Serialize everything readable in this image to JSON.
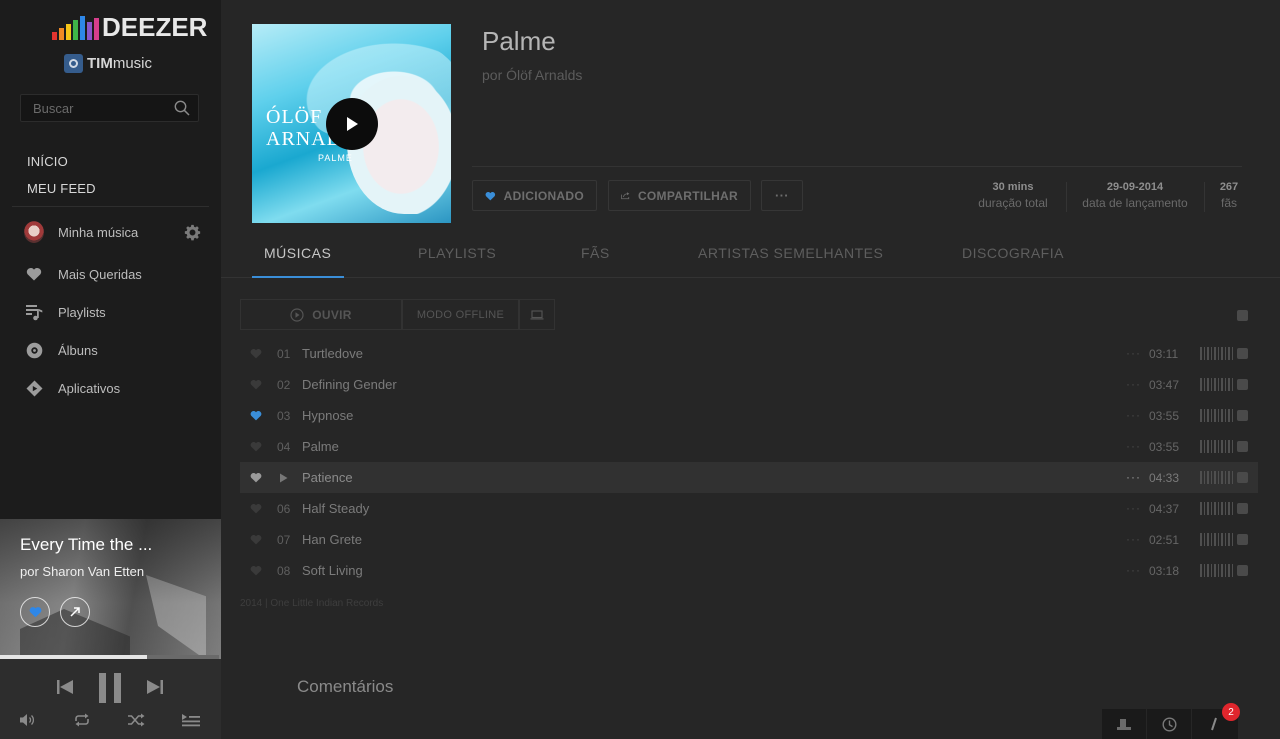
{
  "brand": {
    "logo_text": "DEEZER",
    "partner_bold": "TIM",
    "partner_rest": "music",
    "eq_colors": [
      "#e3342f",
      "#f08a24",
      "#f5c518",
      "#3fb548",
      "#2e87e8",
      "#8a56c9",
      "#d63e8c"
    ]
  },
  "search": {
    "placeholder": "Buscar"
  },
  "nav_top": [
    "INÍCIO",
    "MEU FEED"
  ],
  "sidebar": {
    "items": [
      {
        "label": "Minha música",
        "icon": "avatar"
      },
      {
        "label": "Mais Queridas",
        "icon": "heart-icon"
      },
      {
        "label": "Playlists",
        "icon": "playlist-icon"
      },
      {
        "label": "Álbuns",
        "icon": "album-icon"
      },
      {
        "label": "Aplicativos",
        "icon": "apps-icon"
      }
    ]
  },
  "player": {
    "title": "Every Time the ...",
    "artist": "por Sharon Van Etten",
    "progress": 0.67
  },
  "album": {
    "title": "Palme",
    "by": "por Ólöf Arnalds",
    "cover_text": {
      "line1": "ÓLÖF",
      "line2": "ARNALDS",
      "line3": "PALME"
    },
    "actions": {
      "added": "ADICIONADO",
      "share": "COMPARTILHAR",
      "more": "···"
    },
    "stats": [
      {
        "value": "30 mins",
        "label": "duração total"
      },
      {
        "value": "29-09-2014",
        "label": "data de lançamento"
      },
      {
        "value": "267",
        "label": "fãs"
      }
    ]
  },
  "tabs": [
    "MÚSICAS",
    "PLAYLISTS",
    "FÃS",
    "ARTISTAS SEMELHANTES",
    "DISCOGRAFIA"
  ],
  "toolbar": {
    "listen": "OUVIR",
    "offline": "MODO OFFLINE"
  },
  "tracks": [
    {
      "num": "01",
      "title": "Turtledove",
      "duration": "03:11",
      "favorite": false,
      "playing": false
    },
    {
      "num": "02",
      "title": "Defining Gender",
      "duration": "03:47",
      "favorite": false,
      "playing": false
    },
    {
      "num": "03",
      "title": "Hypnose",
      "duration": "03:55",
      "favorite": true,
      "playing": false
    },
    {
      "num": "04",
      "title": "Palme",
      "duration": "03:55",
      "favorite": false,
      "playing": false
    },
    {
      "num": "",
      "title": "Patience",
      "duration": "04:33",
      "favorite": false,
      "playing": true
    },
    {
      "num": "06",
      "title": "Half Steady",
      "duration": "04:37",
      "favorite": false,
      "playing": false
    },
    {
      "num": "07",
      "title": "Han Grete",
      "duration": "02:51",
      "favorite": false,
      "playing": false
    },
    {
      "num": "08",
      "title": "Soft Living",
      "duration": "03:18",
      "favorite": false,
      "playing": false
    }
  ],
  "label_note": "2014 | One Little Indian Records",
  "comments_title": "Comentários",
  "notifications": {
    "count": "2"
  },
  "colors": {
    "accent": "#3a8ed8",
    "notif": "#e0262d"
  }
}
